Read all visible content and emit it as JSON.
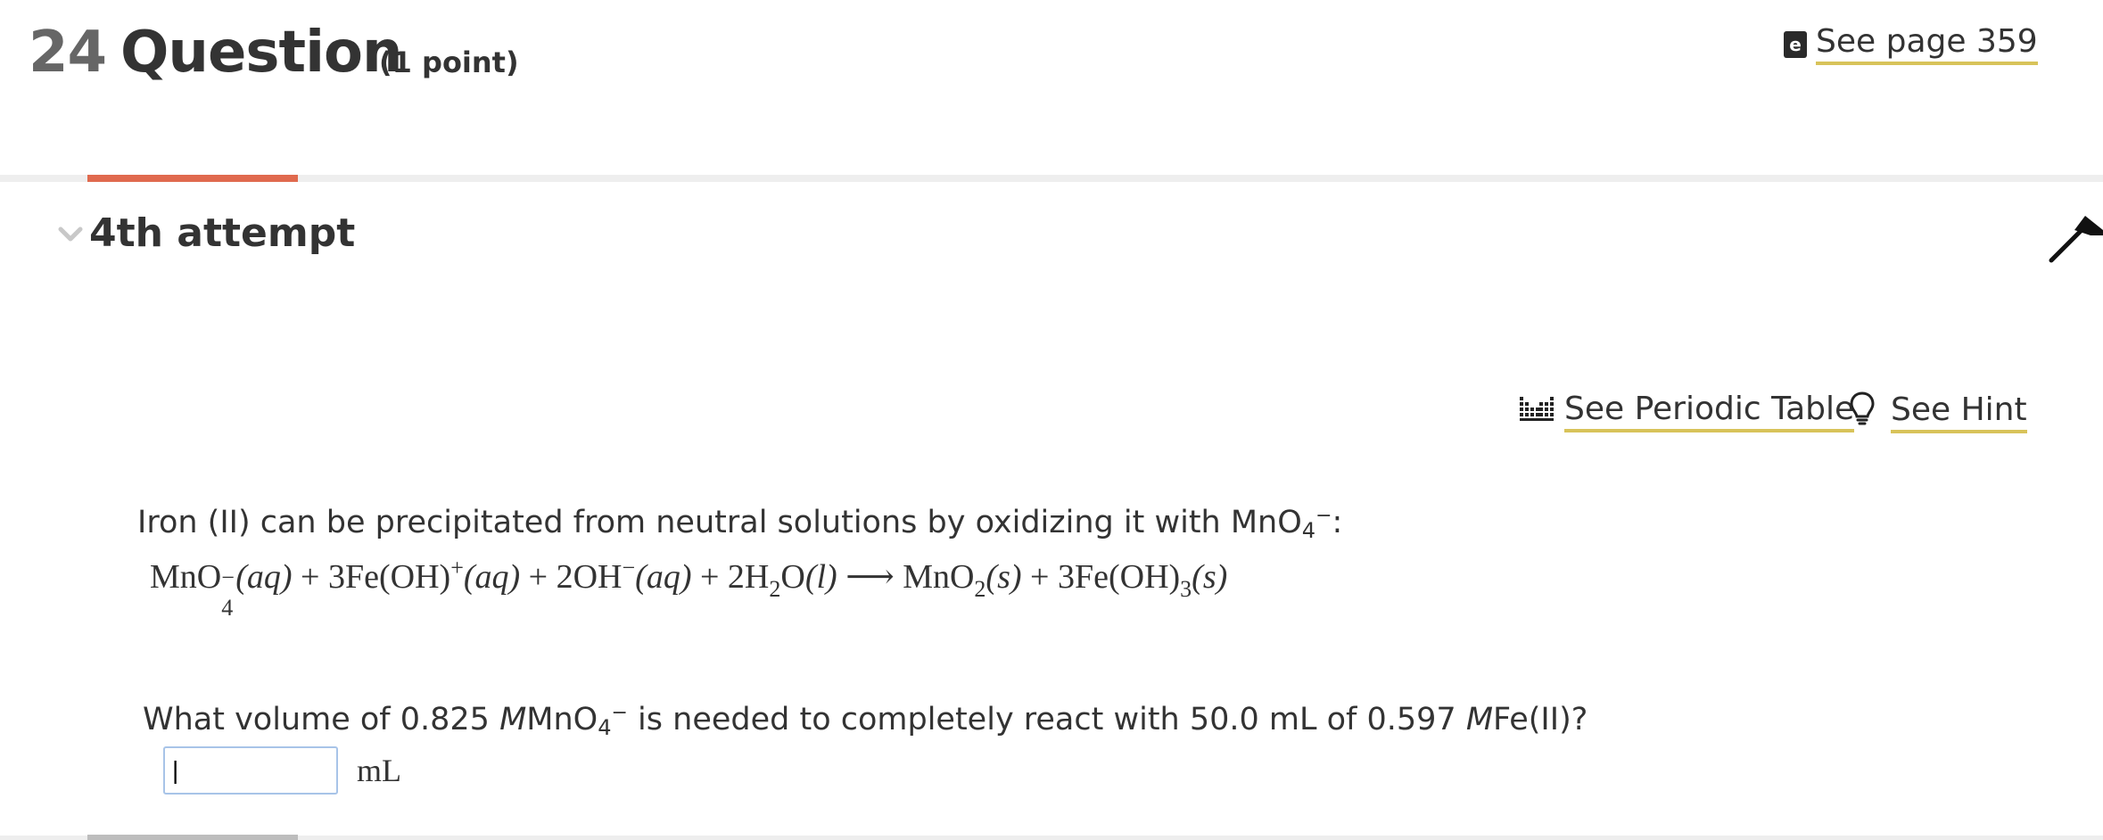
{
  "header": {
    "number": "24",
    "title": "Question",
    "points": "(1 point)",
    "ebook_link": "See page 359",
    "ebook_icon": "e"
  },
  "attempt": {
    "label": "4th attempt"
  },
  "tools": {
    "periodic_table": "See Periodic Table",
    "hint": "See Hint"
  },
  "question": {
    "intro_text": "Iron (II) can be precipitated from neutral solutions by oxidizing it with MnO",
    "intro_sub": "4",
    "intro_sup": "−",
    "intro_end": ":",
    "equation": {
      "r1": "MnO",
      "r1_sub": "4",
      "r1_sup": "−",
      "r1_state": "(aq)",
      "plus1": "+",
      "r2": "3Fe(OH)",
      "r2_sup": "+",
      "r2_state": "(aq)",
      "plus2": "+",
      "r3": "2OH",
      "r3_sup": "−",
      "r3_state": "(aq)",
      "plus3": "+",
      "r4a": "2H",
      "r4_sub": "2",
      "r4b": "O",
      "r4_state": "(l)",
      "arrow": "⟶",
      "p1": "MnO",
      "p1_sub": "2",
      "p1_state": "(s)",
      "plus4": "+",
      "p2": "3Fe(OH)",
      "p2_sub": "3",
      "p2_state": "(s)"
    },
    "prompt_a": "What volume of 0.825 ",
    "prompt_m1": "M",
    "prompt_b": "MnO",
    "prompt_sub": "4",
    "prompt_sup": "−",
    "prompt_c": " is needed to completely react with 50.0 mL of 0.597 ",
    "prompt_m2": "M",
    "prompt_d": "Fe(II)?",
    "answer_value": "|",
    "unit": "mL"
  },
  "colors": {
    "accent_tab": "#e06a4e",
    "link_underline": "#d8c35a",
    "input_border": "#a8c4e8"
  }
}
